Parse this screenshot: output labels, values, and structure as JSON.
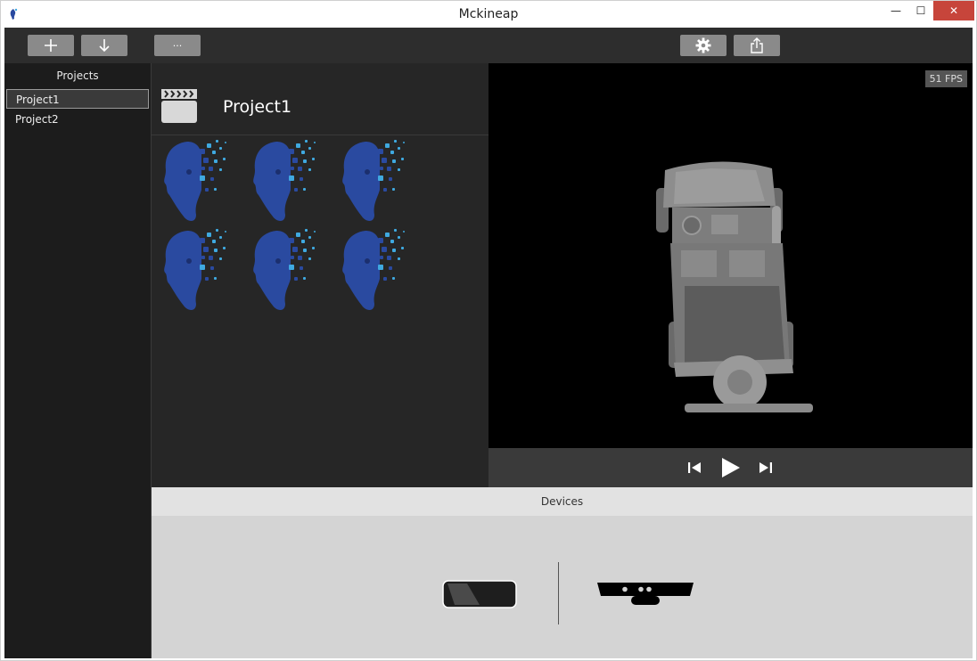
{
  "window": {
    "title": "Mckineap",
    "controls": {
      "minimize": "—",
      "maximize": "☐",
      "close": "✕"
    }
  },
  "toolbar": {
    "buttons": [
      {
        "name": "add",
        "icon": "plus-icon"
      },
      {
        "name": "import",
        "icon": "arrow-down-icon"
      },
      {
        "name": "more",
        "label": "···"
      },
      {
        "name": "settings",
        "icon": "gear-icon"
      },
      {
        "name": "export",
        "icon": "share-icon"
      }
    ]
  },
  "sidebar": {
    "title": "Projects",
    "items": [
      {
        "label": "Project1",
        "selected": true
      },
      {
        "label": "Project2",
        "selected": false
      }
    ]
  },
  "project": {
    "name": "Project1",
    "thumbnail_count": 6
  },
  "viewer": {
    "fps_label": "51 FPS"
  },
  "devices": {
    "title": "Devices"
  },
  "colors": {
    "toolbar_bg": "#2d2d2d",
    "sidebar_bg": "#1c1c1c",
    "viewer_bg": "#000000",
    "close_button": "#c7453b",
    "thumb_blue": "#2a4aa0",
    "thumb_accent": "#3fa9e0"
  }
}
